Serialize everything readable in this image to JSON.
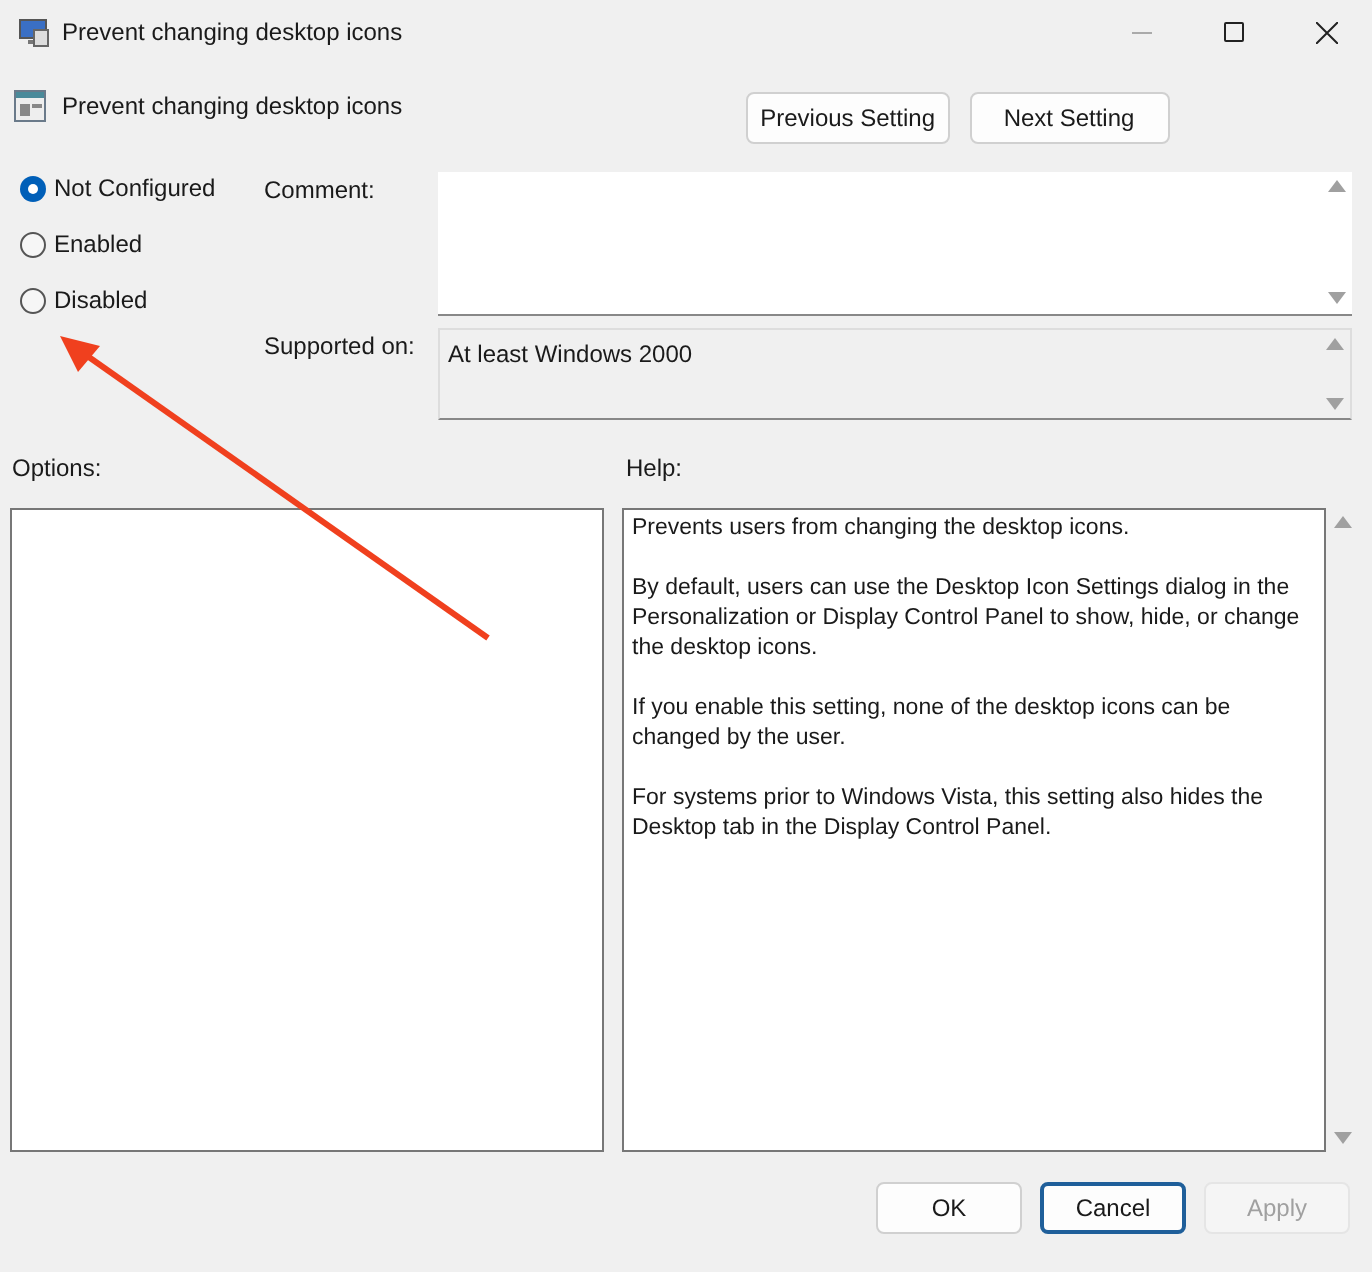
{
  "window": {
    "title": "Prevent changing desktop icons"
  },
  "policy": {
    "name": "Prevent changing desktop icons"
  },
  "nav_buttons": [
    {
      "label": "Previous Setting"
    },
    {
      "label": "Next Setting"
    }
  ],
  "options": [
    {
      "label": "Not Configured",
      "selected": true
    },
    {
      "label": "Enabled",
      "selected": false
    },
    {
      "label": "Disabled",
      "selected": false
    }
  ],
  "comment": {
    "label": "Comment:"
  },
  "supported_on": {
    "label": "Supported on:",
    "value": "At least Windows 2000"
  },
  "options_label": "Options:",
  "help_label": "Help:",
  "help": [
    "Prevents users from changing the desktop icons.",
    "By default, users can use the Desktop Icon Settings dialog in the Personalization or Display Control Panel to show, hide, or change the desktop icons.",
    "If you enable this setting, none of the desktop icons can be changed by the user.",
    "For systems prior to Windows Vista, this setting also hides the Desktop tab in the Display Control Panel."
  ],
  "buttons": [
    {
      "label": "OK",
      "focused": false,
      "disabled": false
    },
    {
      "label": "Cancel",
      "focused": true,
      "disabled": false
    },
    {
      "label": "Apply",
      "focused": false,
      "disabled": true
    }
  ]
}
